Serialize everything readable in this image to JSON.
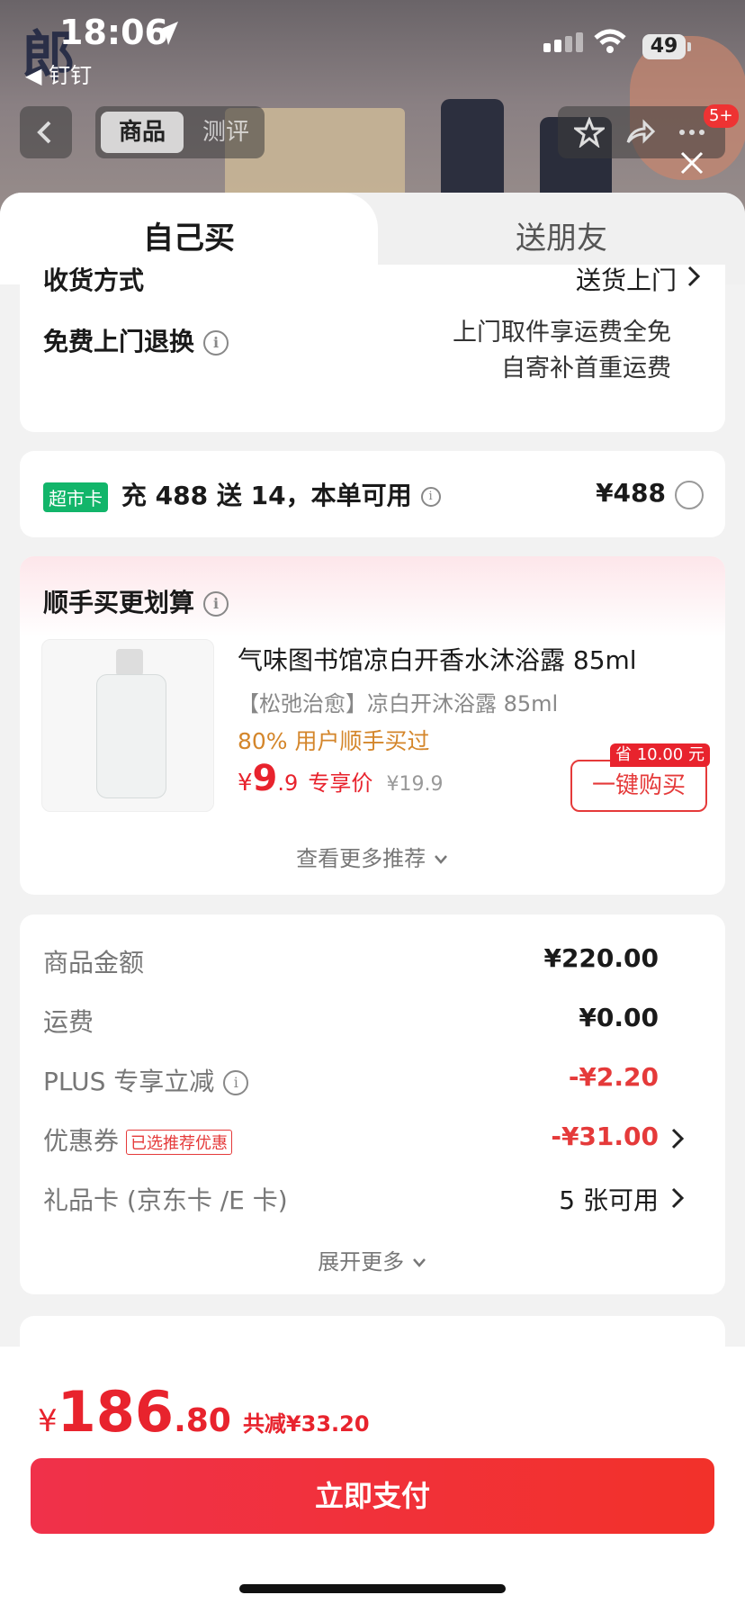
{
  "status_bar": {
    "time": "18:06",
    "back_app": "钉钉",
    "battery": "49"
  },
  "nav": {
    "tab_active": "商品",
    "tab_inactive": "测评",
    "badge": "5+"
  },
  "sheet_tabs": {
    "self": "自己买",
    "gift": "送朋友"
  },
  "delivery": {
    "method_label": "收货方式",
    "method_value": "送货上门",
    "return_label": "免费上门退换",
    "return_line1": "上门取件享运费全免",
    "return_line2": "自寄补首重运费"
  },
  "card_offer": {
    "tag": "超市卡",
    "text": "充 488 送 14，本单可用",
    "price": "¥488"
  },
  "upsell": {
    "title": "顺手买更划算",
    "product_title": "气味图书馆凉白开香水沐浴露 85ml",
    "product_sub": "【松弛治愈】凉白开沐浴露 85ml",
    "social_proof": "80% 用户顺手买过",
    "price_symbol": "¥",
    "price_int": "9",
    "price_dec": ".9",
    "price_label": "专享价",
    "orig_price": "¥19.9",
    "save_tag": "省 10.00 元",
    "buy_label": "一键购买",
    "more": "查看更多推荐"
  },
  "summary": {
    "rows": [
      {
        "label": "商品金额",
        "value": "¥220.00"
      },
      {
        "label": "运费",
        "value": "¥0.00"
      },
      {
        "label": "PLUS 专享立减",
        "value": "-¥2.20"
      },
      {
        "label": "优惠券",
        "tag": "已选推荐优惠",
        "value": "-¥31.00"
      },
      {
        "label": "礼品卡 (京东卡 /E 卡)",
        "value": "5 张可用"
      }
    ],
    "expand": "展开更多"
  },
  "bottom": {
    "currency": "¥",
    "total_int": "186",
    "total_dec": ".80",
    "reduction": "共减¥33.20",
    "pay": "立即支付"
  },
  "colors": {
    "accent_red": "#e8232d",
    "green_tag": "#12b56a",
    "price_orange": "#d4862b"
  }
}
